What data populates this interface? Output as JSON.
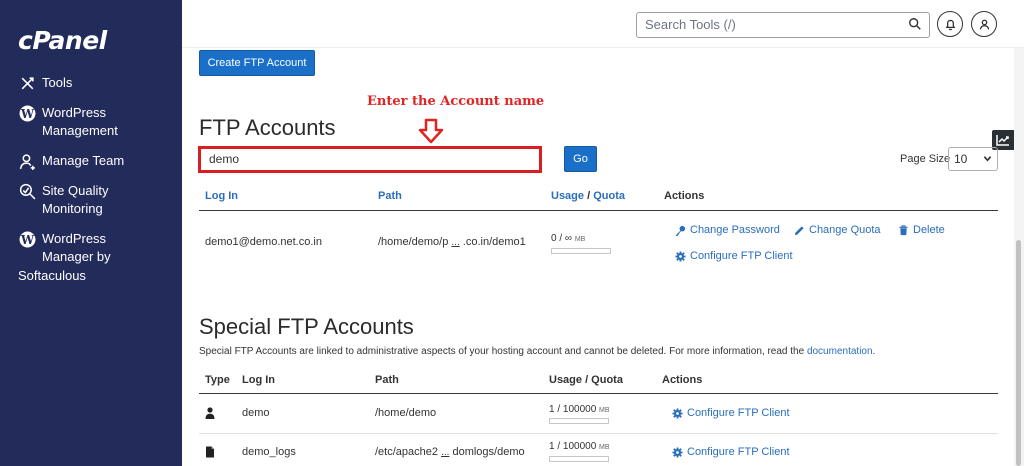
{
  "sidebar": {
    "logo": "cPanel",
    "items": [
      {
        "label": "Tools",
        "icon": "tools-icon"
      },
      {
        "label": "WordPress\nManagement",
        "icon": "wordpress-icon"
      },
      {
        "label": "Manage Team",
        "icon": "team-icon"
      },
      {
        "label": "Site Quality\nMonitoring",
        "icon": "site-quality-icon"
      },
      {
        "label": "WordPress\nManager by",
        "icon": "wordpress-icon"
      }
    ],
    "trailing": "Softaculous"
  },
  "topbar": {
    "search_placeholder": "Search Tools (/)"
  },
  "create_button": "Create FTP Account",
  "annotation": "Enter the Account name",
  "ftp_section": {
    "title": "FTP Accounts",
    "filter_value": "demo",
    "go_label": "Go",
    "page_size_label": "Page Size",
    "page_size_value": "10",
    "headers": {
      "login": "Log In",
      "path": "Path",
      "usage": "Usage",
      "sep": "/",
      "quota": "Quota",
      "actions": "Actions"
    },
    "rows": [
      {
        "login": "demo1@demo.net.co.in",
        "path_start": "/home/demo/p",
        "path_ellipsis": "...",
        "path_end": ".co.in/demo1",
        "usage": "0 / ∞",
        "usage_unit": "MB",
        "usage_fraction": 0,
        "actions": [
          "Change Password",
          "Change Quota",
          "Delete",
          "Configure FTP Client"
        ]
      }
    ]
  },
  "special_section": {
    "title": "Special FTP Accounts",
    "description": "Special FTP Accounts are linked to administrative aspects of your hosting account and cannot be deleted. For more information, read the",
    "description_link": "documentation",
    "description_end": ".",
    "headers": {
      "type": "Type",
      "login": "Log In",
      "path": "Path",
      "usage": "Usage / Quota",
      "actions": "Actions"
    },
    "rows": [
      {
        "type_icon": "user-icon",
        "login": "demo",
        "path_start": "/home/demo",
        "path_ellipsis": "",
        "path_end": "",
        "usage": "1 / 100000",
        "usage_unit": "MB",
        "usage_fraction": 0,
        "action": "Configure FTP Client"
      },
      {
        "type_icon": "file-icon",
        "login": "demo_logs",
        "path_start": "/etc/apache2",
        "path_ellipsis": "...",
        "path_end": "domlogs/demo",
        "usage": "1 / 100000",
        "usage_unit": "MB",
        "usage_fraction": 0,
        "action": "Configure FTP Client"
      }
    ]
  },
  "colors": {
    "sidebar_bg": "#222b5a",
    "primary": "#1a6fc9",
    "link": "#2a6ebb",
    "annotation_red": "#d81e22"
  }
}
